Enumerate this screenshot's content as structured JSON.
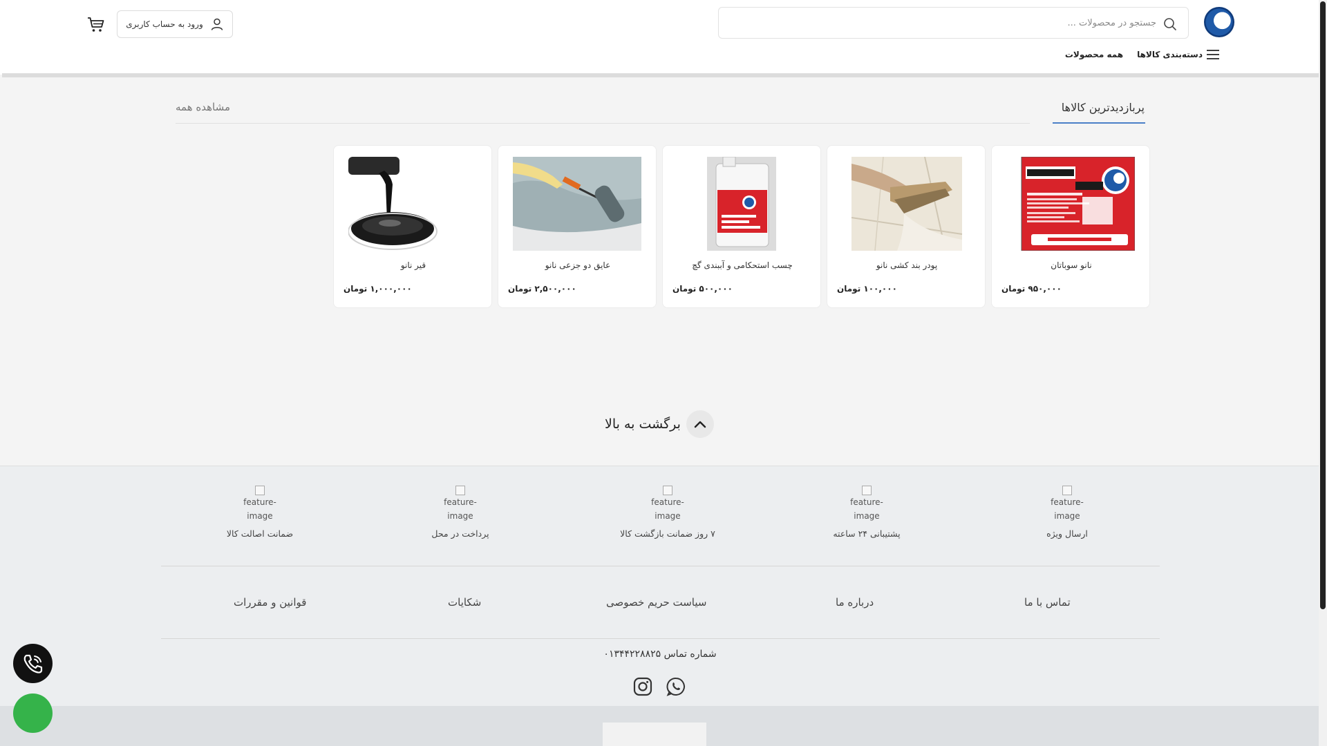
{
  "header": {
    "search_placeholder": "جستجو در محصولات ...",
    "login_label": "ورود به حساب کاربری",
    "nav": [
      {
        "label": "دسته‌بندی کالاها"
      },
      {
        "label": "همه محصولات"
      }
    ]
  },
  "section": {
    "title": "پربازدیدترین کالاها",
    "view_all": "مشاهده همه"
  },
  "products": [
    {
      "name": "نانو سوباتان",
      "price": "۹۵۰,۰۰۰ تومان",
      "image": "nano-sobatan-package"
    },
    {
      "name": "پودر بند کشی نانو",
      "price": "۱۰۰,۰۰۰ تومان",
      "image": "grouting-tiles-photo"
    },
    {
      "name": "چسب استحکامی و آببندی گچ",
      "price": "۵۰۰,۰۰۰ تومان",
      "image": "gallon-container-photo"
    },
    {
      "name": "عایق دو جزعی نانو",
      "price": "۲,۵۰۰,۰۰۰ تومان",
      "image": "paint-roller-photo"
    },
    {
      "name": "قیر نانو",
      "price": "۱,۰۰۰,۰۰۰ تومان",
      "image": "tar-pouring-photo"
    }
  ],
  "back_to_top": "برگشت به بالا",
  "footer": {
    "features": [
      {
        "img_alt": "feature-image",
        "label": "ارسال ویژه"
      },
      {
        "img_alt": "feature-image",
        "label": "پشتیبانی ۲۴ ساعته"
      },
      {
        "img_alt": "feature-image",
        "label": "۷ روز ضمانت بازگشت کالا"
      },
      {
        "img_alt": "feature-image",
        "label": "پرداخت در محل"
      },
      {
        "img_alt": "feature-image",
        "label": "ضمانت اصالت کالا"
      }
    ],
    "links": [
      {
        "label": "تماس با ما"
      },
      {
        "label": "درباره ما"
      },
      {
        "label": "سیاست حریم خصوصی"
      },
      {
        "label": "شکایات"
      },
      {
        "label": "قوانین و مقررات"
      }
    ],
    "phone": "شماره تماس ۰۱۳۴۴۲۲۸۸۲۵",
    "social": [
      "whatsapp-icon",
      "instagram-icon"
    ]
  },
  "colors": {
    "accent": "#4a7fc7",
    "brand_blue": "#1f5aa8",
    "whatsapp_green": "#35b34a",
    "nano_red": "#d8232a"
  }
}
